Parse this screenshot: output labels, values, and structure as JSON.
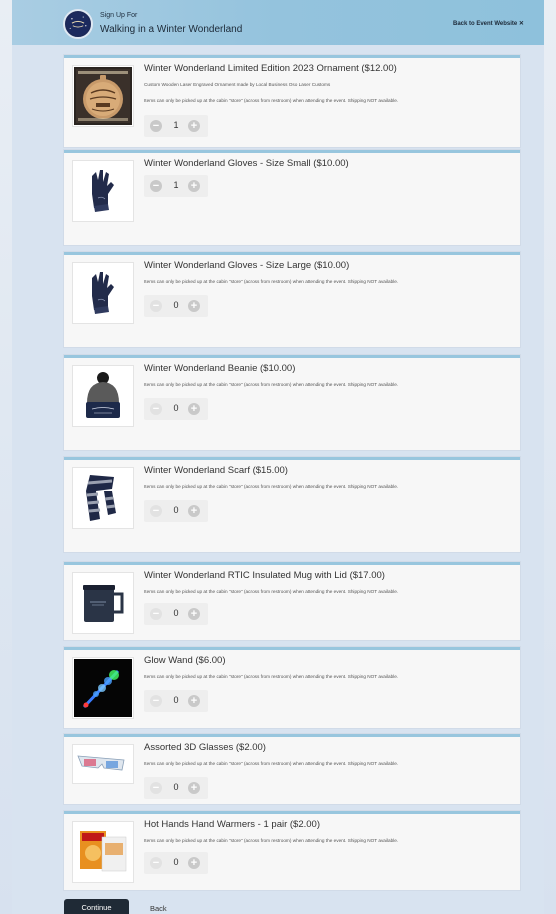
{
  "header": {
    "signup_for": "Sign Up For",
    "event_title": "Walking in a Winter Wonderland",
    "back_link": "Back to Event Website ✕"
  },
  "items": [
    {
      "title": "Winter Wonderland Limited Edition 2023 Ornament ($12.00)",
      "description": "Custom Wooden Laser Engraved Ornament made by Local Business Oso Laser Customs",
      "note": "Items can only be picked up at the cabin \"store\" (across from restroom) when attending the event. Shipping NOT available.",
      "quantity": "1",
      "image_icon": "ornament-icon"
    },
    {
      "title": "Winter Wonderland Gloves - Size Small ($10.00)",
      "note": "",
      "quantity": "1",
      "image_icon": "gloves-icon"
    },
    {
      "title": "Winter Wonderland Gloves - Size Large ($10.00)",
      "note": "Items can only be picked up at the cabin \"store\" (across from restroom) when attending the event. Shipping NOT available.",
      "quantity": "0",
      "image_icon": "gloves-icon"
    },
    {
      "title": "Winter Wonderland Beanie ($10.00)",
      "note": "Items can only be picked up at the cabin \"store\" (across from restroom) when attending the event. Shipping NOT available.",
      "quantity": "0",
      "image_icon": "beanie-icon"
    },
    {
      "title": "Winter Wonderland Scarf ($15.00)",
      "note": "Items can only be picked up at the cabin \"store\" (across from restroom) when attending the event. Shipping NOT available.",
      "quantity": "0",
      "image_icon": "scarf-icon"
    },
    {
      "title": "Winter Wonderland RTIC Insulated Mug with Lid ($17.00)",
      "note": "Items can only be picked up at the cabin \"store\" (across from restroom) when attending the event. Shipping NOT available.",
      "quantity": "0",
      "image_icon": "mug-icon"
    },
    {
      "title": "Glow Wand ($6.00)",
      "note": "Items can only be picked up at the cabin \"store\" (across from restroom) when attending the event. Shipping NOT available.",
      "quantity": "0",
      "image_icon": "glow-wand-icon"
    },
    {
      "title": "Assorted 3D Glasses ($2.00)",
      "note": "Items can only be picked up at the cabin \"store\" (across from restroom) when attending the event. Shipping NOT available.",
      "quantity": "0",
      "image_icon": "3d-glasses-icon"
    },
    {
      "title": "Hot Hands Hand Warmers - 1 pair ($2.00)",
      "note": "Items can only be picked up at the cabin \"store\" (across from restroom) when attending the event. Shipping NOT available.",
      "quantity": "0",
      "image_icon": "hand-warmers-icon"
    }
  ],
  "footer": {
    "continue_label": "Continue",
    "back_label": "Back"
  },
  "colors": {
    "header_bg": "#94c3dd",
    "card_accent": "#98c6de",
    "continue_bg": "#1f2a36",
    "page_bg": "#d8e3f0"
  }
}
